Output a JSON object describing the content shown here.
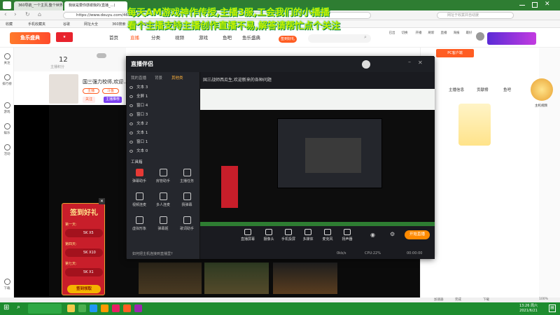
{
  "tabs": [
    "360导航_一个主页,整个世界",
    "我就是要你感谢我的(直播_…)"
  ],
  "url": "https://www.douyu.com/4658240",
  "search_placeholder": "网址于收案并自动援",
  "bookmarks": [
    "收藏",
    "手机收藏夹",
    "谷歌",
    "网址大全",
    "360搜索",
    "游戏中心",
    "淘宝网",
    "斗鱼"
  ],
  "browser_icons": [
    "已出",
    "切换",
    "开播",
    "刷新",
    "直播",
    "海报",
    "最好"
  ],
  "overlay": {
    "line1": "每天AM游戏神作传授,主播3服,工会我们的小播播",
    "line2": "看个主播支持主播创作直播不易,解答请帮忙点个关注"
  },
  "douyu": {
    "logo": "鱼乐盛典",
    "nav": [
      "首页",
      "直播",
      "分类",
      "视频",
      "游戏",
      "鱼吧",
      "鱼乐盛典"
    ],
    "hot": "签到好礼",
    "right_links": [
      "登录",
      "注册"
    ]
  },
  "sidebar": [
    "关注",
    "排行榜",
    "游戏",
    "娱乐",
    "活动",
    "下载"
  ],
  "room": {
    "fans": "12",
    "fans_label": "主播积分",
    "streamer_name": "国三强力校师,欢迎…",
    "follow": "关注",
    "badges": [
      "主播",
      "斗鱼"
    ],
    "tags": [
      "主播推荐",
      "福利直播"
    ]
  },
  "live_companion": {
    "title": "直播伴侣",
    "tabs": [
      "我的直播",
      "背景",
      "其他类"
    ],
    "layers": [
      "文本 3",
      "全屏 1",
      "窗口 4",
      "窗口 3",
      "文本 2",
      "文本 1",
      "窗口 1",
      "文本 0"
    ],
    "tools_header": "工具箱",
    "tools": [
      "弹幕助手",
      "房管助手",
      "主播任务",
      "视频连麦",
      "多人连麦",
      "猜弹幕",
      "虚拟形象",
      "弹幕姬",
      "歌词助手",
      "直播间设",
      "更多",
      "素材"
    ],
    "announcement": "国三战师西瓜生,欢迎新来的各种问题",
    "controls": [
      "直播屏幕",
      "摄像头",
      "手机投屏",
      "多媒体",
      "麦克风",
      "扬声器"
    ],
    "go_live": "开始直播",
    "status_hint": "如何把主机连接到直播里?",
    "rate": "0kb/s",
    "cpu": "CPU:22%",
    "timer": "00:00:00",
    "status_items": [
      "分辨率",
      "帧率"
    ]
  },
  "checkin": {
    "title": "签到好礼",
    "days": [
      "第一天:",
      "第四天:",
      "第七天:"
    ],
    "rewards": [
      "5K",
      "5K",
      "5K"
    ],
    "multipliers": [
      "X5",
      "X10",
      "X1"
    ],
    "button": "签到领取"
  },
  "right_panel": {
    "tabs": [
      "主播信息",
      "贡献榜",
      "鱼吧"
    ],
    "pc_button": "PC客户端",
    "side_label": "主机视频"
  },
  "statusbar": [
    "加速器",
    "完成",
    "下载",
    "100%"
  ],
  "taskbar": {
    "time": "13:26 周六",
    "date": "2021/6/21"
  },
  "colors": {
    "browser_green": "#2e7d32",
    "taskbar": "#1e8c2f",
    "douyu_orange": "#ff5d23",
    "overlay_text": "#c8f000",
    "go_live": "#ff8a00"
  }
}
